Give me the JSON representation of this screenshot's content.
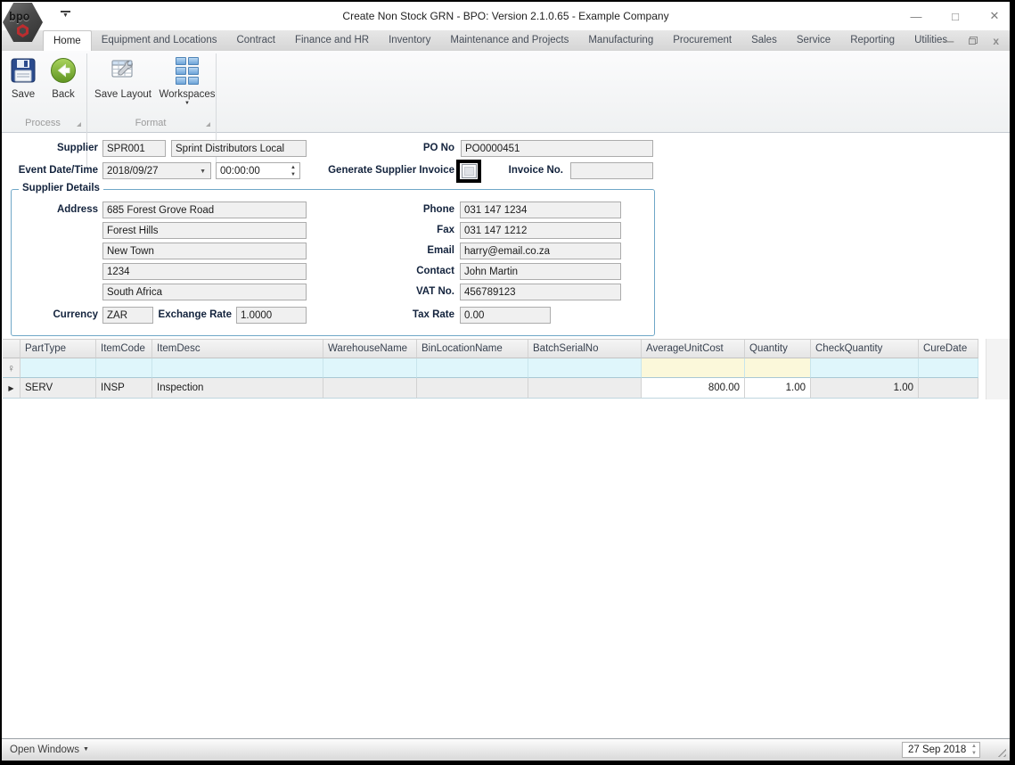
{
  "window": {
    "title": "Create Non Stock GRN - BPO: Version 2.1.0.65 - Example Company",
    "logo_text": "bpo"
  },
  "icons": {
    "minimize": "—",
    "maximize": "□",
    "close": "✕",
    "mdi_minimize": "—",
    "mdi_close": "x",
    "dropdown": "▼",
    "spin_up": "▲",
    "spin_down": "▼",
    "qat_arrow": "▼",
    "filter_pin": "♀",
    "row_arrow": "▶"
  },
  "ribbon": {
    "tabs": [
      {
        "label": "Home",
        "active": true
      },
      {
        "label": "Equipment and Locations",
        "active": false
      },
      {
        "label": "Contract",
        "active": false
      },
      {
        "label": "Finance and HR",
        "active": false
      },
      {
        "label": "Inventory",
        "active": false
      },
      {
        "label": "Maintenance and Projects",
        "active": false
      },
      {
        "label": "Manufacturing",
        "active": false
      },
      {
        "label": "Procurement",
        "active": false
      },
      {
        "label": "Sales",
        "active": false
      },
      {
        "label": "Service",
        "active": false
      },
      {
        "label": "Reporting",
        "active": false
      },
      {
        "label": "Utilities",
        "active": false
      }
    ],
    "buttons": {
      "save": "Save",
      "back": "Back",
      "save_layout": "Save Layout",
      "workspaces": "Workspaces"
    },
    "groups": {
      "process": "Process",
      "format": "Format"
    }
  },
  "form": {
    "supplier_label": "Supplier",
    "supplier_code": "SPR001",
    "supplier_name": "Sprint Distributors Local",
    "po_no_label": "PO No",
    "po_no": "PO0000451",
    "event_datetime_label": "Event Date/Time",
    "event_date": "2018/09/27",
    "event_time": "00:00:00",
    "generate_invoice_label": "Generate Supplier Invoice",
    "invoice_no_label": "Invoice No.",
    "invoice_no": ""
  },
  "supplier_details": {
    "title": "Supplier Details",
    "address_label": "Address",
    "address_lines": [
      "685 Forest Grove Road",
      "Forest Hills",
      "New Town",
      "1234",
      "South Africa"
    ],
    "currency_label": "Currency",
    "currency": "ZAR",
    "exchange_rate_label": "Exchange Rate",
    "exchange_rate": "1.0000",
    "details_right": [
      {
        "label": "Phone",
        "value": "031 147 1234"
      },
      {
        "label": "Fax",
        "value": "031 147 1212"
      },
      {
        "label": "Email",
        "value": "harry@email.co.za"
      },
      {
        "label": "Contact",
        "value": "John Martin"
      },
      {
        "label": "VAT No.",
        "value": "456789123"
      }
    ],
    "tax_rate_label": "Tax Rate",
    "tax_rate": "0.00"
  },
  "grid": {
    "columns": [
      "PartType",
      "ItemCode",
      "ItemDesc",
      "WarehouseName",
      "BinLocationName",
      "BatchSerialNo",
      "AverageUnitCost",
      "Quantity",
      "CheckQuantity",
      "CureDate"
    ],
    "rows": [
      [
        "SERV",
        "INSP",
        "Inspection",
        "",
        "",
        "",
        "800.00",
        "1.00",
        "1.00",
        ""
      ]
    ]
  },
  "statusbar": {
    "open_windows_label": "Open Windows",
    "date_value": "27 Sep 2018"
  }
}
